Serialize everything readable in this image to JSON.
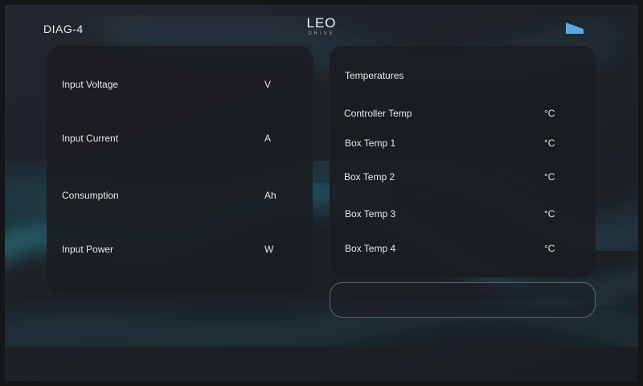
{
  "header": {
    "title": "DIAG-4",
    "logo_main": "LEO",
    "logo_sub": "DRIVE",
    "signal_icon": "signal-strength-icon"
  },
  "power_panel": {
    "rows": [
      {
        "label": "Input Voltage",
        "unit": "V"
      },
      {
        "label": "Input Current",
        "unit": "A"
      },
      {
        "label": "Consumption",
        "unit": "Ah"
      },
      {
        "label": "Input Power",
        "unit": "W"
      }
    ]
  },
  "temperature_panel": {
    "heading": "Temperatures",
    "rows": [
      {
        "label": "Controller Temp",
        "unit": "°C"
      },
      {
        "label": "Box Temp 1",
        "unit": "°C"
      },
      {
        "label": "Box Temp 2",
        "unit": "°C"
      },
      {
        "label": "Box Temp 3",
        "unit": "°C"
      },
      {
        "label": "Box Temp 4",
        "unit": "°C"
      }
    ]
  },
  "status_box": {
    "text": ""
  },
  "colors": {
    "background": "#1e2227",
    "panel": "#1a1c20",
    "text": "#e4e6ea",
    "accent": "#5aa9e6",
    "wave": "#2a8f9a"
  }
}
